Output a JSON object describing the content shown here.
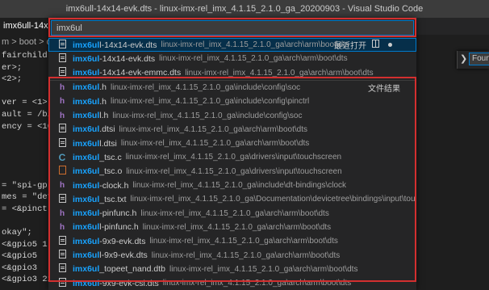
{
  "window": {
    "title": "imx6ull-14x14-evk.dts - linux-imx-rel_imx_4.1.15_2.1.0_ga_20200903 - Visual Studio Code"
  },
  "tab": {
    "label": "imx6ull-14x1"
  },
  "breadcrumb": {
    "text": "m > boot > dts"
  },
  "editor": {
    "lines": [
      "fairchild,",
      "er>;",
      "<2>;",
      "",
      "ver = <1>;",
      "ault = /bit",
      "ency = <100",
      "",
      "",
      "",
      "",
      "= \"spi-gp",
      "mes = \"def",
      "= <&pinctr",
      "",
      "okay\";",
      "<&gpio5 1",
      "<&gpio5",
      "<&gpio3",
      "<&gpio3 22 0>;"
    ]
  },
  "find_widget": {
    "value": "Foun"
  },
  "quick_open": {
    "query": "imx6ul",
    "recent_label": "最近打开",
    "file_results_label": "文件结果",
    "recent": [
      {
        "icon": "file-icon",
        "match": "imx6ul",
        "rest": "l-14x14-evk.dts",
        "path": "linux-imx-rel_imx_4.1.15_2.1.0_ga\\arch\\arm\\boot\\dts"
      },
      {
        "icon": "file-icon",
        "match": "imx6ul",
        "rest": "-14x14-evk.dts",
        "path": "linux-imx-rel_imx_4.1.15_2.1.0_ga\\arch\\arm\\boot\\dts"
      },
      {
        "icon": "file-icon",
        "match": "imx6ul",
        "rest": "-14x14-evk-emmc.dts",
        "path": "linux-imx-rel_imx_4.1.15_2.1.0_ga\\arch\\arm\\boot\\dts"
      }
    ],
    "files": [
      {
        "icon": "h-icon",
        "match": "imx6ul",
        "rest": ".h",
        "path": "linux-imx-rel_imx_4.1.15_2.1.0_ga\\include\\config\\soc"
      },
      {
        "icon": "h-icon",
        "match": "imx6ul",
        "rest": ".h",
        "path": "linux-imx-rel_imx_4.1.15_2.1.0_ga\\include\\config\\pinctrl"
      },
      {
        "icon": "h-icon",
        "match": "imx6ul",
        "rest": "l.h",
        "path": "linux-imx-rel_imx_4.1.15_2.1.0_ga\\include\\config\\soc"
      },
      {
        "icon": "file-icon",
        "match": "imx6ul",
        "rest": ".dtsi",
        "path": "linux-imx-rel_imx_4.1.15_2.1.0_ga\\arch\\arm\\boot\\dts"
      },
      {
        "icon": "file-icon",
        "match": "imx6ul",
        "rest": "l.dtsi",
        "path": "linux-imx-rel_imx_4.1.15_2.1.0_ga\\arch\\arm\\boot\\dts"
      },
      {
        "icon": "c-icon",
        "match": "imx6ul",
        "rest": "_tsc.c",
        "path": "linux-imx-rel_imx_4.1.15_2.1.0_ga\\drivers\\input\\touchscreen"
      },
      {
        "icon": "o-icon",
        "match": "imx6ul",
        "rest": "_tsc.o",
        "path": "linux-imx-rel_imx_4.1.15_2.1.0_ga\\drivers\\input\\touchscreen"
      },
      {
        "icon": "h-icon",
        "match": "imx6ul",
        "rest": "-clock.h",
        "path": "linux-imx-rel_imx_4.1.15_2.1.0_ga\\include\\dt-bindings\\clock"
      },
      {
        "icon": "file-icon",
        "match": "imx6ul",
        "rest": "_tsc.txt",
        "path": "linux-imx-rel_imx_4.1.15_2.1.0_ga\\Documentation\\devicetree\\bindings\\input\\touchscreen"
      },
      {
        "icon": "h-icon",
        "match": "imx6ul",
        "rest": "-pinfunc.h",
        "path": "linux-imx-rel_imx_4.1.15_2.1.0_ga\\arch\\arm\\boot\\dts"
      },
      {
        "icon": "h-icon",
        "match": "imx6ul",
        "rest": "l-pinfunc.h",
        "path": "linux-imx-rel_imx_4.1.15_2.1.0_ga\\arch\\arm\\boot\\dts"
      },
      {
        "icon": "file-icon",
        "match": "imx6ul",
        "rest": "-9x9-evk.dts",
        "path": "linux-imx-rel_imx_4.1.15_2.1.0_ga\\arch\\arm\\boot\\dts"
      },
      {
        "icon": "file-icon",
        "match": "imx6ul",
        "rest": "l-9x9-evk.dts",
        "path": "linux-imx-rel_imx_4.1.15_2.1.0_ga\\arch\\arm\\boot\\dts"
      },
      {
        "icon": "file-icon",
        "match": "imx6ul",
        "rest": "_topeet_nand.dtb",
        "path": "linux-imx-rel_imx_4.1.15_2.1.0_ga\\arch\\arm\\boot\\dts"
      },
      {
        "icon": "file-icon",
        "match": "imx6ul",
        "rest": "-9x9-evk-csi.dts",
        "path": "linux-imx-rel_imx_4.1.15_2.1.0_ga\\arch\\arm\\boot\\dts"
      }
    ]
  },
  "colors": {
    "accent": "#007acc",
    "match": "#18a3ff",
    "annotation": "#d32f2f"
  }
}
